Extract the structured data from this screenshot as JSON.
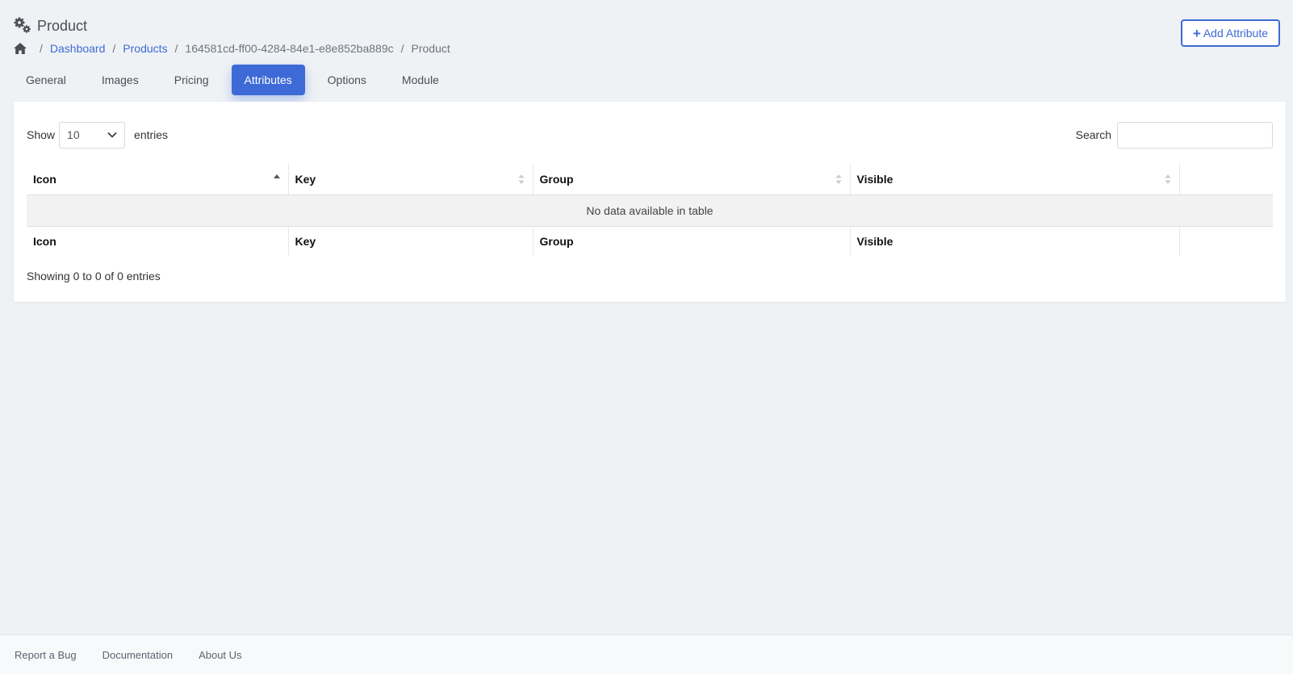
{
  "header": {
    "title": "Product",
    "title_icon": "gears-icon",
    "add_button_label": "Add Attribute"
  },
  "breadcrumb": {
    "home_icon": "home-icon",
    "items": [
      {
        "label": "Dashboard",
        "link": true
      },
      {
        "label": "Products",
        "link": true
      },
      {
        "label": "164581cd-ff00-4284-84e1-e8e852ba889c",
        "link": false
      },
      {
        "label": "Product",
        "link": false
      }
    ],
    "separator": "/"
  },
  "tabs": [
    {
      "label": "General",
      "active": false
    },
    {
      "label": "Images",
      "active": false
    },
    {
      "label": "Pricing",
      "active": false
    },
    {
      "label": "Attributes",
      "active": true
    },
    {
      "label": "Options",
      "active": false
    },
    {
      "label": "Module",
      "active": false
    }
  ],
  "table_controls": {
    "show_label": "Show",
    "entries_label": "entries",
    "page_length": "10",
    "search_label": "Search",
    "search_value": ""
  },
  "table": {
    "columns": [
      "Icon",
      "Key",
      "Group",
      "Visible",
      ""
    ],
    "sorted_column": "Icon",
    "sort_direction": "asc",
    "empty_message": "No data available in table",
    "info": "Showing 0 to 0 of 0 entries"
  },
  "footer": {
    "links": [
      "Report a Bug",
      "Documentation",
      "About Us"
    ]
  },
  "colors": {
    "accent": "#3d6ad6",
    "background": "#eff2f5"
  }
}
